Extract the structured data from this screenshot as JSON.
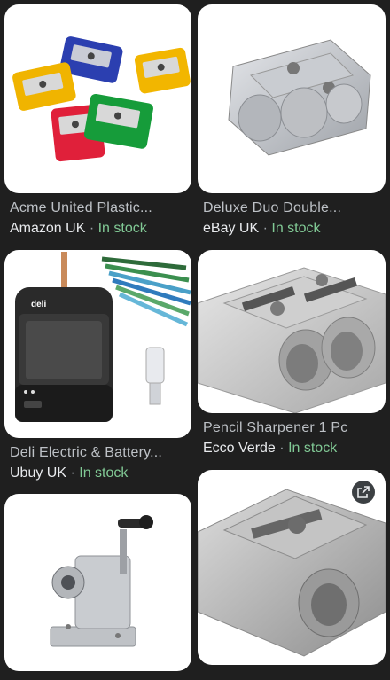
{
  "results": [
    {
      "title": "Acme United Plastic...",
      "source": "Amazon UK",
      "status": "In stock"
    },
    {
      "title": "Deluxe Duo Double...",
      "source": "eBay UK",
      "status": "In stock"
    },
    {
      "title": "Deli Electric & Battery...",
      "source": "Ubuy UK",
      "status": "In stock",
      "image_brand": "deli"
    },
    {
      "title": "Pencil Sharpener 1 Pc",
      "source": "Ecco Verde",
      "status": "In stock"
    },
    {
      "title": "",
      "source": "",
      "status": ""
    },
    {
      "title": "",
      "source": "",
      "status": ""
    }
  ],
  "separator": "·",
  "icons": {
    "external_link": "open-in-new-icon"
  },
  "colors": {
    "background": "#1f1f1f",
    "status_in_stock": "#81c995",
    "title": "#bdc1c6",
    "source": "#e8eaed"
  }
}
